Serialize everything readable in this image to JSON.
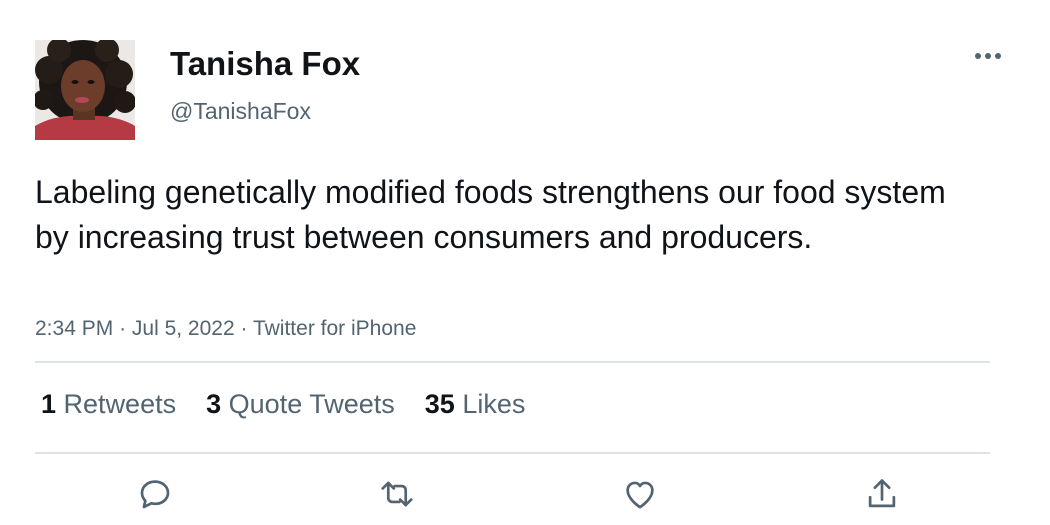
{
  "user": {
    "display_name": "Tanisha Fox",
    "handle": "@TanishaFox",
    "avatar_icon": "profile-photo"
  },
  "tweet": {
    "text": "Labeling genetically modified foods strengthens our food system by increasing trust between consumers and producers.",
    "time": "2:34 PM",
    "date": "Jul 5, 2022",
    "source": "Twitter for iPhone",
    "separator": "·"
  },
  "stats": {
    "retweets": {
      "count": "1",
      "label": "Retweets"
    },
    "quote_tweets": {
      "count": "3",
      "label": "Quote Tweets"
    },
    "likes": {
      "count": "35",
      "label": "Likes"
    }
  },
  "icons": {
    "more": "more-horizontal-icon",
    "reply": "reply-icon",
    "retweet": "retweet-icon",
    "like": "heart-icon",
    "share": "share-icon"
  },
  "colors": {
    "text": "#0f1419",
    "secondary": "#536471",
    "divider": "#dde2e6",
    "icon": "#536471"
  }
}
